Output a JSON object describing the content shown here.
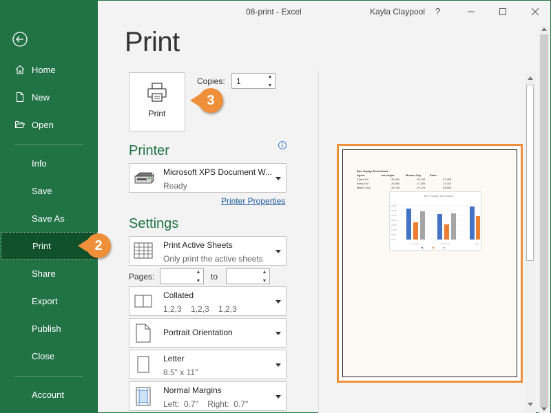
{
  "titlebar": {
    "title": "08-print  -  Excel",
    "user": "Kayla Claypool",
    "help": "?"
  },
  "sidebar": {
    "items": [
      {
        "label": "Home",
        "icon": "home-icon"
      },
      {
        "label": "New",
        "icon": "new-document-icon"
      },
      {
        "label": "Open",
        "icon": "folder-open-icon"
      },
      {
        "label": "Info"
      },
      {
        "label": "Save"
      },
      {
        "label": "Save As"
      },
      {
        "label": "Print",
        "active": true
      },
      {
        "label": "Share"
      },
      {
        "label": "Export"
      },
      {
        "label": "Publish"
      },
      {
        "label": "Close"
      },
      {
        "label": "Account"
      }
    ]
  },
  "callouts": {
    "step2": "2",
    "step3": "3"
  },
  "main": {
    "title": "Print",
    "print_button": "Print",
    "copies_label": "Copies:",
    "copies_value": "1",
    "printer_heading": "Printer",
    "printer": {
      "name": "Microsoft XPS Document W...",
      "status": "Ready"
    },
    "printer_properties": "Printer Properties",
    "settings_heading": "Settings",
    "settings": [
      {
        "line1": "Print Active Sheets",
        "line2": "Only print the active sheets",
        "icon": "sheets-grid-icon"
      },
      {
        "line1": "Collated",
        "line2": "1,2,3    1,2,3    1,2,3",
        "icon": "collated-pages-icon"
      },
      {
        "line1": "Portrait Orientation",
        "line2": "",
        "icon": "portrait-page-icon"
      },
      {
        "line1": "Letter",
        "line2": "8.5\" x 11\"",
        "icon": "paper-size-icon"
      },
      {
        "line1": "Normal Margins",
        "line2": "Left:  0.7\"    Right:  0.7\"",
        "icon": "margins-icon"
      }
    ],
    "pages_label": "Pages:",
    "to_label": "to",
    "pages_from": "",
    "pages_to": ""
  },
  "preview": {
    "sheet_title": "Bon Voyage Excursions",
    "headers": [
      "Agent",
      "Las Vegas",
      "Mexico City",
      "Paris"
    ],
    "rows": [
      [
        "Claire Pin",
        "35,350",
        "28,125",
        "37,455"
      ],
      [
        "Kerry Oki",
        "20,850",
        "17,200",
        "27,010"
      ],
      [
        "Mario Cruz",
        "33,750",
        "29,175",
        "35,840"
      ]
    ],
    "chart_title": "Bon Voyage Excursions"
  },
  "colors": {
    "brand_green": "#217346",
    "active_green": "#10502b",
    "callout_orange": "#ef8f3a",
    "series_blue": "#4472c4",
    "series_orange": "#ed7d31",
    "series_gray": "#a5a5a5"
  }
}
